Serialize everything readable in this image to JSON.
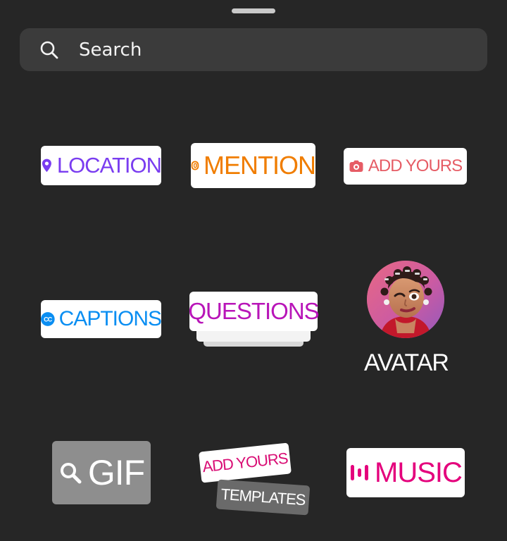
{
  "search": {
    "placeholder": "Search"
  },
  "stickers": {
    "location": {
      "label": "LOCATION",
      "icon": "location-pin-icon",
      "color": "#7a3df0"
    },
    "mention": {
      "label": "MENTION",
      "icon": "mention-at-icon",
      "color": "#f07d00"
    },
    "add_yours": {
      "label": "ADD YOURS",
      "icon": "camera-icon",
      "color": "#e65c65"
    },
    "captions": {
      "label": "CAPTIONS",
      "icon_text": "CC",
      "icon": "closed-captions-icon",
      "color": "#0a8ef2"
    },
    "questions": {
      "label": "QUESTIONS",
      "color": "#b815b8"
    },
    "avatar": {
      "label": "AVATAR",
      "image": "avatar-character-image"
    },
    "gif": {
      "label": "GIF",
      "icon": "search-icon"
    },
    "templates": {
      "top_label": "ADD YOURS",
      "bottom_label": "TEMPLATES"
    },
    "music": {
      "label": "MUSIC",
      "icon": "music-bars-icon",
      "color": "#e4007c"
    }
  },
  "colors": {
    "background": "#262626",
    "search_background": "#3b3b3b",
    "grabber": "#c9c9c9"
  }
}
